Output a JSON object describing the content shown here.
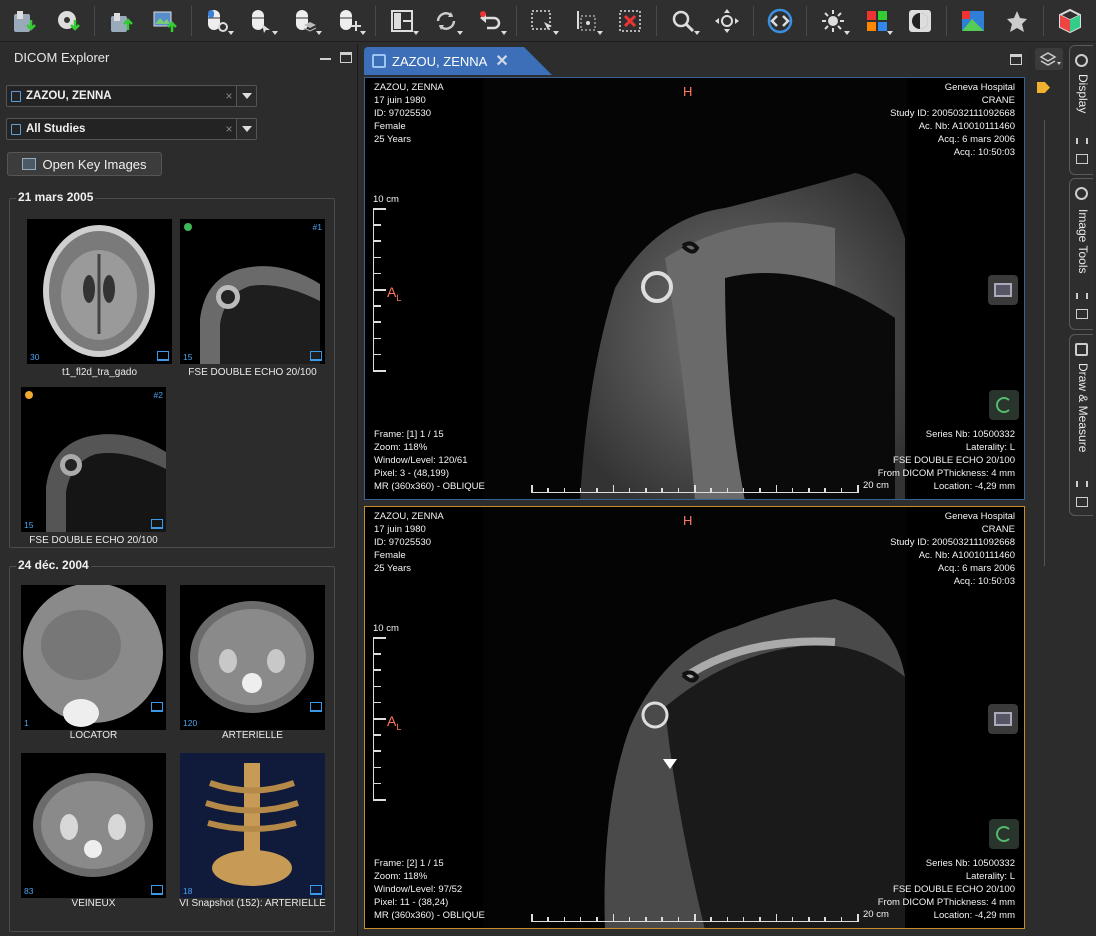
{
  "toolbar": {
    "tools": [
      {
        "name": "import-dicom-icon"
      },
      {
        "name": "import-cd-icon"
      },
      {
        "name": "export-dicom-icon"
      },
      {
        "name": "export-image-icon"
      },
      {
        "name": "mouse-left-window-icon"
      },
      {
        "name": "mouse-middle-pan-icon"
      },
      {
        "name": "mouse-right-layers-icon"
      },
      {
        "name": "mouse-wheel-cross-icon"
      },
      {
        "name": "layout-grid-icon"
      },
      {
        "name": "synch-icon"
      },
      {
        "name": "reset-icon"
      },
      {
        "name": "measure-select-icon"
      },
      {
        "name": "point-select-icon"
      },
      {
        "name": "delete-selection-icon"
      },
      {
        "name": "zoom-icon"
      },
      {
        "name": "pan-crosshair-icon"
      },
      {
        "name": "sequence-icon"
      },
      {
        "name": "brightness-icon"
      },
      {
        "name": "lut-color-icon"
      },
      {
        "name": "invert-icon"
      },
      {
        "name": "image-export-color-icon"
      },
      {
        "name": "tool-star-icon"
      },
      {
        "name": "volume-cube-icon"
      }
    ]
  },
  "explorer": {
    "title": "DICOM Explorer",
    "patient": "ZAZOU, ZENNA",
    "studies": "All Studies",
    "open_key_images": "Open Key Images",
    "groups": [
      {
        "date": "21 mars 2005",
        "items": [
          {
            "caption": "t1_fl2d_tra_gado",
            "count": "30",
            "series": ""
          },
          {
            "caption": "FSE DOUBLE ECHO 20/100",
            "count": "15",
            "series": "#1",
            "dot": "#3db858"
          },
          {
            "caption": "FSE DOUBLE ECHO 20/100",
            "count": "15",
            "series": "#2",
            "dot": "#f0a830"
          }
        ]
      },
      {
        "date": "24 déc. 2004",
        "items": [
          {
            "caption": "LOCATOR",
            "count": "1",
            "series": ""
          },
          {
            "caption": "ARTERIELLE",
            "count": "120",
            "series": ""
          },
          {
            "caption": "VEINEUX",
            "count": "83",
            "series": ""
          },
          {
            "caption": "VI Snapshot (152): ARTERIELLE",
            "count": "18",
            "series": ""
          }
        ]
      }
    ]
  },
  "viewer": {
    "tab_label": "ZAZOU, ZENNA",
    "views": [
      {
        "tl": [
          "ZAZOU, ZENNA",
          "17 juin 1980",
          "ID: 97025530",
          "Female",
          "25 Years"
        ],
        "tr": [
          "Geneva Hospital",
          "CRANE",
          "Study ID: 2005032111092668",
          "Ac. Nb: A10010111460",
          "Acq.: 6 mars 2006",
          "Acq.: 10:50:03"
        ],
        "bl": [
          "Frame: [1] 1 / 15",
          "Zoom: 118%",
          "Window/Level: 120/61",
          "Pixel: 3 - (48,199)",
          "MR (360x360) - OBLIQUE"
        ],
        "br": [
          "Series Nb: 10500332",
          "Laterality: L",
          "FSE DOUBLE ECHO 20/100",
          "From DICOM PThickness: 4 mm",
          "Location: -4,29 mm"
        ],
        "orient_top": "H",
        "orient_left": "A",
        "orient_left_sub": "L",
        "scale_v": "10 cm",
        "scale_h": "20 cm"
      },
      {
        "tl": [
          "ZAZOU, ZENNA",
          "17 juin 1980",
          "ID: 97025530",
          "Female",
          "25 Years"
        ],
        "tr": [
          "Geneva Hospital",
          "CRANE",
          "Study ID: 2005032111092668",
          "Ac. Nb: A10010111460",
          "Acq.: 6 mars 2006",
          "Acq.: 10:50:03"
        ],
        "bl": [
          "Frame: [2] 1 / 15",
          "Zoom: 118%",
          "Window/Level: 97/52",
          "Pixel: 11 - (38,24)",
          "MR (360x360) - OBLIQUE"
        ],
        "br": [
          "Series Nb: 10500332",
          "Laterality: L",
          "FSE DOUBLE ECHO 20/100",
          "From DICOM PThickness: 4 mm",
          "Location: -4,29 mm"
        ],
        "orient_top": "H",
        "orient_left": "A",
        "orient_left_sub": "L",
        "scale_v": "10 cm",
        "scale_h": "20 cm"
      }
    ]
  },
  "right_panels": [
    {
      "label": "Display"
    },
    {
      "label": "Image Tools"
    },
    {
      "label": "Draw & Measure"
    }
  ],
  "colors": {
    "accent": "#3d6fb8",
    "active_border": "#c98c2a",
    "orientation": "#ff7860",
    "thumb_number": "#4aa3f0"
  }
}
